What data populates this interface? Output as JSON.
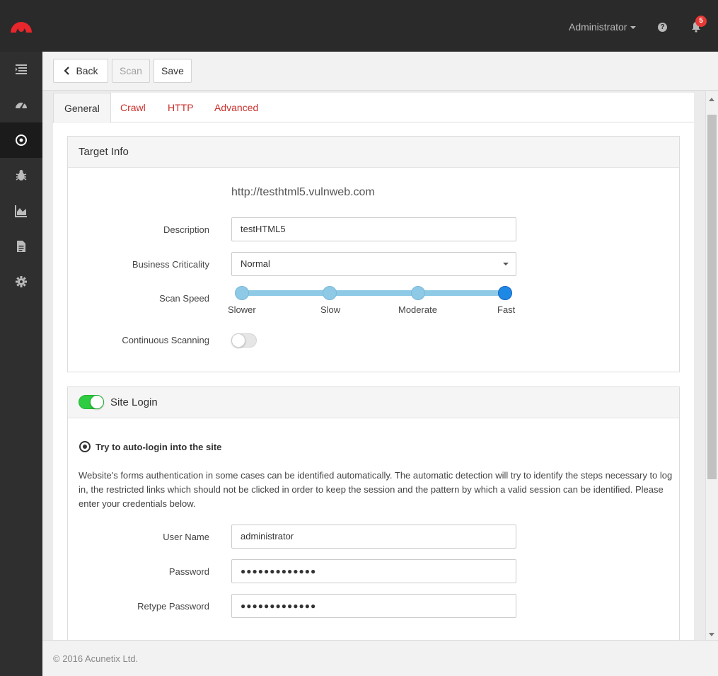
{
  "header": {
    "user_menu": "Administrator",
    "help_icon": "?",
    "notifications_count": "5"
  },
  "sidebar": {
    "items": [
      {
        "icon": "dashboard-list-icon"
      },
      {
        "icon": "speedometer-icon"
      },
      {
        "icon": "target-icon",
        "active": true
      },
      {
        "icon": "bug-icon"
      },
      {
        "icon": "area-chart-icon"
      },
      {
        "icon": "document-icon"
      },
      {
        "icon": "gear-icon"
      }
    ]
  },
  "toolbar": {
    "back_label": "Back",
    "scan_label": "Scan",
    "save_label": "Save"
  },
  "tabs": [
    "General",
    "Crawl",
    "HTTP",
    "Advanced"
  ],
  "target_info": {
    "title": "Target Info",
    "url": "http://testhtml5.vulnweb.com",
    "description_label": "Description",
    "description_value": "testHTML5",
    "criticality_label": "Business Criticality",
    "criticality_value": "Normal",
    "scan_speed_label": "Scan Speed",
    "scan_speed_options": [
      "Slower",
      "Slow",
      "Moderate",
      "Fast"
    ],
    "scan_speed_selected": "Fast",
    "continuous_label": "Continuous Scanning",
    "continuous_enabled": false
  },
  "site_login": {
    "title": "Site Login",
    "enabled": true,
    "option_label": "Try to auto-login into the site",
    "description": "Website's forms authentication in some cases can be identified automatically. The automatic detection will try to identify the steps necessary to log in, the restricted links which should not be clicked in order to keep the session and the pattern by which a valid session can be identified. Please enter your credentials below.",
    "username_label": "User Name",
    "username_value": "administrator",
    "password_label": "Password",
    "password_value": "●●●●●●●●●●●●●",
    "retype_label": "Retype Password",
    "retype_value": "●●●●●●●●●●●●●"
  },
  "footer": {
    "copyright": "© 2016 Acunetix Ltd."
  },
  "colors": {
    "topbar": "#2a2a2a",
    "accent_red": "#c9302c",
    "toggle_on": "#2ecc40",
    "slider": "#8ecae6",
    "slider_selected": "#1e88e5"
  }
}
